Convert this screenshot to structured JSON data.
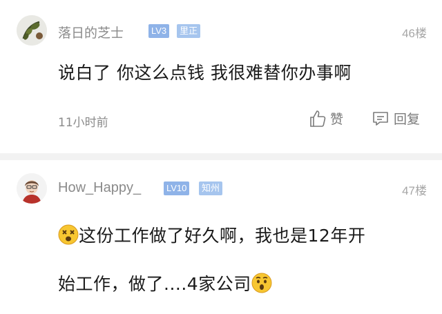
{
  "comments": [
    {
      "username": "落日的芝士",
      "level": "LV3",
      "region": "里正",
      "floor": "46楼",
      "content": "说白了 你这么点钱 我很难替你办事啊",
      "time": "11小时前",
      "like_label": "赞",
      "reply_label": "回复",
      "avatar_icon": "avatar-plant-icon"
    },
    {
      "username": "How_Happy_",
      "level": "LV10",
      "region": "知州",
      "floor": "47楼",
      "content_line1": "这份工作做了好久啊，我也是12年开",
      "content_line2": "始工作，做了....4家公司",
      "leading_emoji": "dizzy-face-emoji",
      "trailing_emoji": "anxious-face-emoji",
      "avatar_icon": "avatar-person-icon"
    }
  ],
  "colors": {
    "badge_level": "#8fb3e8",
    "badge_region": "#a6c5ee",
    "text_primary": "#1a1a1a",
    "text_secondary": "#8a8a8a"
  }
}
